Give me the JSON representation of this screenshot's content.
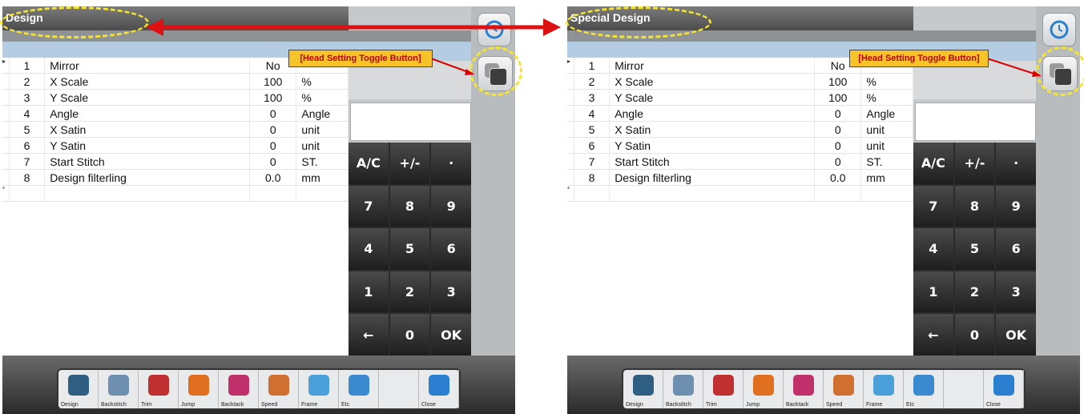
{
  "left_panel": {
    "title": "Design",
    "rows": [
      {
        "marker": "▸",
        "num": "1",
        "name": "Mirror",
        "value": "No",
        "unit": ""
      },
      {
        "marker": "",
        "num": "2",
        "name": "X Scale",
        "value": "100",
        "unit": "%"
      },
      {
        "marker": "",
        "num": "3",
        "name": "Y Scale",
        "value": "100",
        "unit": "%"
      },
      {
        "marker": "",
        "num": "4",
        "name": "Angle",
        "value": "0",
        "unit": "Angle"
      },
      {
        "marker": "",
        "num": "5",
        "name": "X Satin",
        "value": "0",
        "unit": "unit"
      },
      {
        "marker": "",
        "num": "6",
        "name": "Y Satin",
        "value": "0",
        "unit": "unit"
      },
      {
        "marker": "",
        "num": "7",
        "name": "Start Stitch",
        "value": "0",
        "unit": "ST."
      },
      {
        "marker": "",
        "num": "8",
        "name": "Design filterling",
        "value": "0.0",
        "unit": "mm"
      },
      {
        "marker": "*",
        "num": "",
        "name": "",
        "value": "",
        "unit": ""
      }
    ]
  },
  "right_panel": {
    "title": "Special Design",
    "rows": [
      {
        "marker": "▸",
        "num": "1",
        "name": "Mirror",
        "value": "No",
        "unit": ""
      },
      {
        "marker": "",
        "num": "2",
        "name": "X Scale",
        "value": "100",
        "unit": "%"
      },
      {
        "marker": "",
        "num": "3",
        "name": "Y Scale",
        "value": "100",
        "unit": "%"
      },
      {
        "marker": "",
        "num": "4",
        "name": "Angle",
        "value": "0",
        "unit": "Angle"
      },
      {
        "marker": "",
        "num": "5",
        "name": "X Satin",
        "value": "0",
        "unit": "unit"
      },
      {
        "marker": "",
        "num": "6",
        "name": "Y Satin",
        "value": "0",
        "unit": "unit"
      },
      {
        "marker": "",
        "num": "7",
        "name": "Start Stitch",
        "value": "0",
        "unit": "ST."
      },
      {
        "marker": "",
        "num": "8",
        "name": "Design filterling",
        "value": "0.0",
        "unit": "mm"
      },
      {
        "marker": "*",
        "num": "",
        "name": "",
        "value": "",
        "unit": ""
      }
    ]
  },
  "keypad": [
    "A/C",
    "+/-",
    "·",
    "7",
    "8",
    "9",
    "4",
    "5",
    "6",
    "1",
    "2",
    "3",
    "←",
    "0",
    "OK"
  ],
  "toolbar": [
    {
      "label": "Design",
      "icon": "design-icon",
      "color": "#2e5f83"
    },
    {
      "label": "Backstitch",
      "icon": "backstitch-icon",
      "color": "#6f8fb0"
    },
    {
      "label": "Trim",
      "icon": "scissors-icon",
      "color": "#c03030"
    },
    {
      "label": "Jump",
      "icon": "jump-icon",
      "color": "#e07020"
    },
    {
      "label": "Backtack",
      "icon": "backtack-icon",
      "color": "#c0306a"
    },
    {
      "label": "Speed",
      "icon": "speed-gauge-icon",
      "color": "#d07030"
    },
    {
      "label": "Frame",
      "icon": "frame-icon",
      "color": "#4aa0d8"
    },
    {
      "label": "Etc",
      "icon": "more-dots-icon",
      "color": "#3a8ad0"
    },
    {
      "label": "",
      "icon": "blank-icon",
      "color": "#e8eaec"
    },
    {
      "label": "Close",
      "icon": "close-arrow-icon",
      "color": "#2a7fd0"
    }
  ],
  "callout": "[Head Setting Toggle Button]",
  "colors": {
    "accent": "#d11111",
    "highlight": "#f5e430",
    "callout_bg": "#f7c32a",
    "callout_text": "#c00000"
  }
}
